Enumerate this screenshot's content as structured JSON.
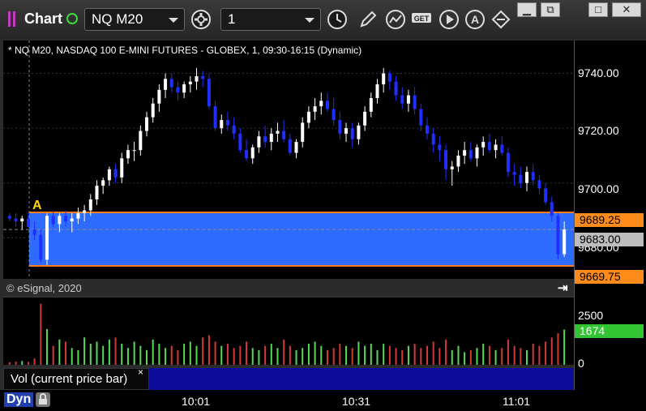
{
  "app": {
    "title": "Chart"
  },
  "toolbar": {
    "symbol": "NQ M20",
    "interval": "1",
    "icons": [
      "settings-gear-icon",
      "clock-icon",
      "pencil-icon",
      "study-icon",
      "get-icon",
      "play-icon",
      "annotate-a-icon",
      "flip-icon"
    ]
  },
  "window_buttons": {
    "restore": "⧉",
    "max": "□",
    "close": "✕"
  },
  "chart": {
    "info_line": "* NQ M20, NASDAQ 100 E-MINI FUTURES - GLOBEX, 1, 09:30-16:15 (Dynamic)",
    "copyright": "© eSignal, 2020",
    "marker_label": "A",
    "price_ticks": [
      "9740.00",
      "9720.00",
      "9700.00",
      "9680.00"
    ],
    "price_badges": {
      "upper": "9689.25",
      "current": "9683.00",
      "lower": "9669.75"
    },
    "volume_ticks": [
      "2500",
      "0"
    ],
    "volume_badge": "1674",
    "time_labels": [
      "10:01",
      "10:31",
      "11:01"
    ],
    "colors": {
      "background": "#000000",
      "zone": "#2e6cff",
      "zone_border": "#ff7a1a",
      "up_bar": "#ffffff",
      "down_bar": "#1f2fff",
      "vol_up": "#56d956",
      "vol_down": "#d13a3a",
      "badge_orange": "#ff8c1a",
      "badge_green": "#33c433"
    }
  },
  "chart_data": {
    "type": "candlestick",
    "price_axis": [
      9665,
      9752
    ],
    "price_marks": [
      9740,
      9720,
      9700,
      9680
    ],
    "candles": [
      [
        9688,
        9689,
        9686,
        9687
      ],
      [
        9687,
        9689,
        9684,
        9686
      ],
      [
        9686,
        9688,
        9683,
        9687
      ],
      [
        9687,
        9689,
        9684,
        9684
      ],
      [
        9683,
        9686,
        9679,
        9681
      ],
      [
        9681,
        9683,
        9671,
        9672
      ],
      [
        9672,
        9689,
        9670,
        9688
      ],
      [
        9688,
        9690,
        9684,
        9685
      ],
      [
        9685,
        9689,
        9682,
        9688
      ],
      [
        9688,
        9690,
        9684,
        9686
      ],
      [
        9686,
        9689,
        9682,
        9687
      ],
      [
        9687,
        9691,
        9685,
        9689
      ],
      [
        9689,
        9692,
        9686,
        9690
      ],
      [
        9690,
        9696,
        9688,
        9694
      ],
      [
        9694,
        9701,
        9692,
        9699
      ],
      [
        9699,
        9702,
        9696,
        9701
      ],
      [
        9701,
        9706,
        9699,
        9705
      ],
      [
        9705,
        9707,
        9700,
        9702
      ],
      [
        9702,
        9711,
        9700,
        9709
      ],
      [
        9709,
        9714,
        9707,
        9712
      ],
      [
        9712,
        9715,
        9708,
        9712
      ],
      [
        9712,
        9721,
        9710,
        9719
      ],
      [
        9719,
        9726,
        9717,
        9724
      ],
      [
        9724,
        9731,
        9722,
        9729
      ],
      [
        9729,
        9736,
        9726,
        9734
      ],
      [
        9734,
        9740,
        9731,
        9738
      ],
      [
        9738,
        9740,
        9733,
        9735
      ],
      [
        9735,
        9737,
        9730,
        9733
      ],
      [
        9733,
        9737,
        9731,
        9736
      ],
      [
        9736,
        9739,
        9733,
        9737
      ],
      [
        9737,
        9742,
        9734,
        9739
      ],
      [
        9739,
        9741,
        9735,
        9738
      ],
      [
        9738,
        9740,
        9727,
        9728
      ],
      [
        9728,
        9730,
        9719,
        9720
      ],
      [
        9720,
        9725,
        9718,
        9723
      ],
      [
        9723,
        9726,
        9719,
        9721
      ],
      [
        9721,
        9724,
        9716,
        9718
      ],
      [
        9718,
        9720,
        9711,
        9712
      ],
      [
        9712,
        9716,
        9708,
        9709
      ],
      [
        9709,
        9714,
        9707,
        9713
      ],
      [
        9713,
        9719,
        9711,
        9717
      ],
      [
        9717,
        9721,
        9713,
        9715
      ],
      [
        9715,
        9720,
        9712,
        9718
      ],
      [
        9718,
        9722,
        9715,
        9719
      ],
      [
        9719,
        9723,
        9715,
        9716
      ],
      [
        9716,
        9718,
        9710,
        9711
      ],
      [
        9711,
        9716,
        9709,
        9715
      ],
      [
        9715,
        9724,
        9713,
        9722
      ],
      [
        9722,
        9728,
        9720,
        9726
      ],
      [
        9726,
        9731,
        9723,
        9728
      ],
      [
        9728,
        9733,
        9725,
        9730
      ],
      [
        9730,
        9733,
        9726,
        9727
      ],
      [
        9727,
        9731,
        9721,
        9723
      ],
      [
        9723,
        9726,
        9716,
        9718
      ],
      [
        9718,
        9722,
        9715,
        9720
      ],
      [
        9720,
        9722,
        9713,
        9716
      ],
      [
        9716,
        9722,
        9714,
        9721
      ],
      [
        9721,
        9728,
        9719,
        9726
      ],
      [
        9726,
        9733,
        9724,
        9731
      ],
      [
        9731,
        9738,
        9729,
        9736
      ],
      [
        9736,
        9742,
        9733,
        9740
      ],
      [
        9740,
        9741,
        9734,
        9737
      ],
      [
        9737,
        9739,
        9730,
        9732
      ],
      [
        9732,
        9735,
        9727,
        9729
      ],
      [
        9729,
        9734,
        9726,
        9732
      ],
      [
        9732,
        9735,
        9725,
        9727
      ],
      [
        9727,
        9729,
        9719,
        9721
      ],
      [
        9721,
        9724,
        9716,
        9718
      ],
      [
        9718,
        9720,
        9711,
        9714
      ],
      [
        9714,
        9717,
        9708,
        9712
      ],
      [
        9712,
        9714,
        9701,
        9705
      ],
      [
        9705,
        9708,
        9699,
        9706
      ],
      [
        9706,
        9712,
        9704,
        9710
      ],
      [
        9710,
        9715,
        9707,
        9712
      ],
      [
        9712,
        9715,
        9708,
        9709
      ],
      [
        9709,
        9714,
        9706,
        9713
      ],
      [
        9713,
        9717,
        9710,
        9715
      ],
      [
        9715,
        9718,
        9711,
        9712
      ],
      [
        9712,
        9716,
        9709,
        9714
      ],
      [
        9714,
        9717,
        9710,
        9711
      ],
      [
        9711,
        9713,
        9702,
        9704
      ],
      [
        9704,
        9707,
        9699,
        9703
      ],
      [
        9703,
        9706,
        9698,
        9700
      ],
      [
        9700,
        9706,
        9697,
        9704
      ],
      [
        9704,
        9707,
        9699,
        9701
      ],
      [
        9701,
        9703,
        9696,
        9698
      ],
      [
        9698,
        9700,
        9692,
        9693
      ],
      [
        9693,
        9695,
        9686,
        9688
      ],
      [
        9688,
        9689,
        9672,
        9674
      ],
      [
        9674,
        9686,
        9673,
        9683
      ]
    ],
    "zone": {
      "upper": 9689.25,
      "lower": 9669.75,
      "current": 9683.0
    },
    "volume_axis": [
      0,
      3200
    ],
    "volume": [
      120,
      150,
      180,
      140,
      300,
      2900,
      1700,
      900,
      1200,
      1100,
      800,
      700,
      1300,
      1000,
      1100,
      900,
      1200,
      1300,
      1000,
      800,
      1100,
      900,
      700,
      1200,
      1000,
      800,
      900,
      700,
      1000,
      1100,
      900,
      1300,
      1400,
      1100,
      900,
      1000,
      800,
      900,
      1100,
      800,
      700,
      900,
      1000,
      800,
      1200,
      900,
      700,
      800,
      1000,
      1100,
      900,
      700,
      800,
      1000,
      900,
      800,
      1100,
      900,
      1000,
      700,
      1000,
      900,
      800,
      700,
      900,
      1000,
      800,
      900,
      1100,
      800,
      1200,
      700,
      900,
      600,
      700,
      800,
      1000,
      900,
      700,
      800,
      1200,
      900,
      800,
      700,
      1000,
      900,
      1100,
      1300,
      1500,
      1674
    ]
  },
  "volume_panel": {
    "label": "Vol (current price bar)",
    "close": "×"
  },
  "footer": {
    "mode": "Dyn"
  }
}
